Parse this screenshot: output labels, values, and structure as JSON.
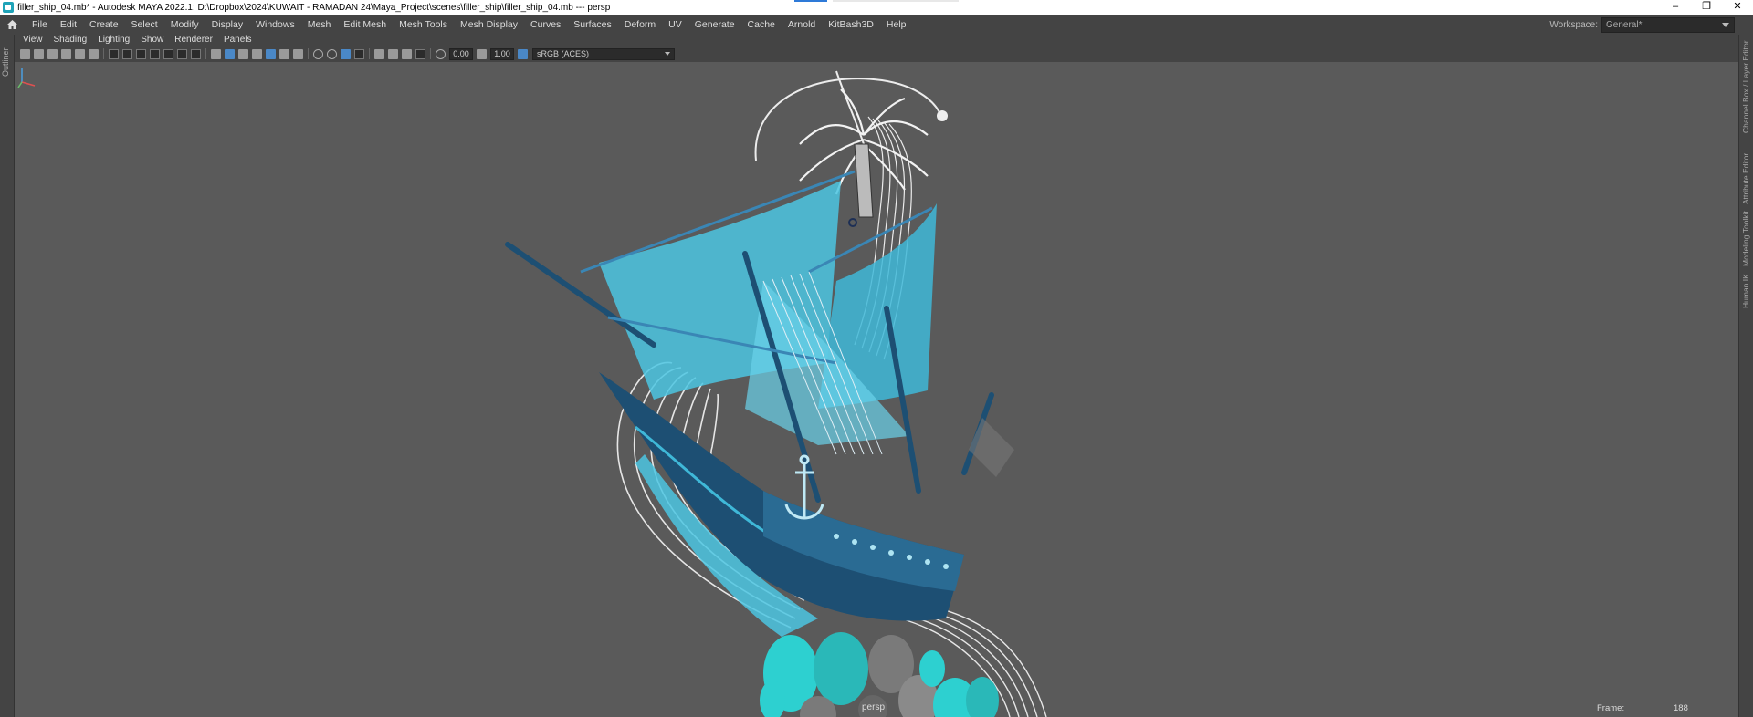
{
  "window": {
    "title": "filler_ship_04.mb* - Autodesk MAYA 2022.1: D:\\Dropbox\\2024\\KUWAIT - RAMADAN 24\\Maya_Project\\scenes\\filler_ship\\filler_ship_04.mb  ---  persp",
    "controls": [
      "–",
      "❐",
      "✕"
    ]
  },
  "menubar": {
    "items": [
      "File",
      "Edit",
      "Create",
      "Select",
      "Modify",
      "Display",
      "Windows",
      "Mesh",
      "Edit Mesh",
      "Mesh Tools",
      "Mesh Display",
      "Curves",
      "Surfaces",
      "Deform",
      "UV",
      "Generate",
      "Cache",
      "Arnold",
      "KitBash3D",
      "Help"
    ]
  },
  "workspace": {
    "label": "Workspace:",
    "value": "General*"
  },
  "left_dock": {
    "label": "Outliner"
  },
  "right_dock": {
    "tabs": [
      "Channel Box / Layer Editor",
      "Attribute Editor",
      "Modeling Toolkit",
      "Human IK"
    ]
  },
  "panel_menu": {
    "items": [
      "View",
      "Shading",
      "Lighting",
      "Show",
      "Renderer",
      "Panels"
    ]
  },
  "panel_toolbar": {
    "exposure": "0.00",
    "gamma": "1.00",
    "colorspace": "sRGB (ACES)"
  },
  "viewport": {
    "camera": "persp",
    "frame_label": "Frame:",
    "frame_value": "188"
  },
  "colors": {
    "viewport_bg": "#5a5a5a",
    "ship_dark": "#1d4f73",
    "ship_light": "#3fb8d8",
    "sail": "#4cc6e2",
    "coral_teal": "#2dd0d0",
    "coral_gray": "#7a7a7a",
    "curves": "#e8e8e8"
  }
}
